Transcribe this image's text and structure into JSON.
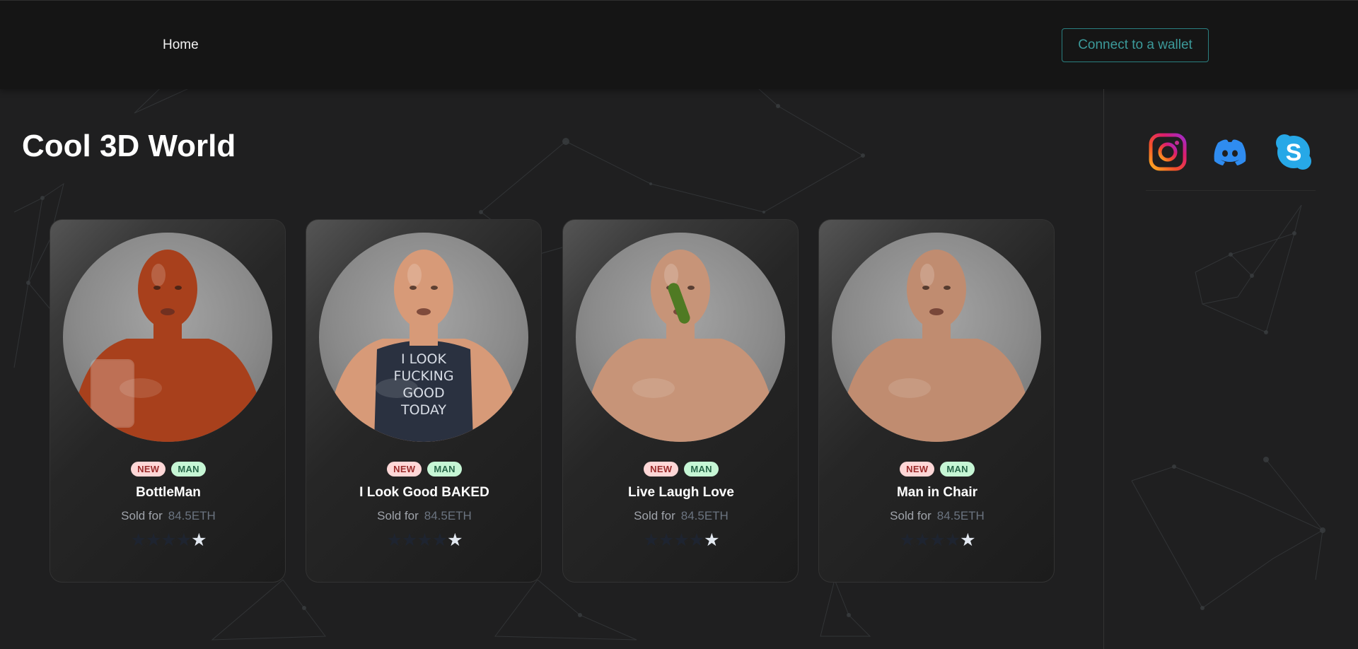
{
  "nav": {
    "home": "Home"
  },
  "wallet": {
    "label": "Connect to a wallet"
  },
  "page": {
    "title": "Cool 3D World"
  },
  "social": [
    "instagram-icon",
    "discord-icon",
    "skype-icon"
  ],
  "cards": [
    {
      "tag_new": "NEW",
      "tag_man": "MAN",
      "name": "BottleMan",
      "sold_label": "Sold for",
      "price": "84.5ETH",
      "rating": 4,
      "rating_max": 5,
      "skin": "#a8401c",
      "shirt": ""
    },
    {
      "tag_new": "NEW",
      "tag_man": "MAN",
      "name": "I Look Good BAKED",
      "sold_label": "Sold for",
      "price": "84.5ETH",
      "rating": 4,
      "rating_max": 5,
      "skin": "#d79a78",
      "shirt": "#2a3140"
    },
    {
      "tag_new": "NEW",
      "tag_man": "MAN",
      "name": "Live Laugh Love",
      "sold_label": "Sold for",
      "price": "84.5ETH",
      "rating": 4,
      "rating_max": 5,
      "skin": "#c79478",
      "shirt": ""
    },
    {
      "tag_new": "NEW",
      "tag_man": "MAN",
      "name": "Man in Chair",
      "sold_label": "Sold for",
      "price": "84.5ETH",
      "rating": 4,
      "rating_max": 5,
      "skin": "#c08c70",
      "shirt": ""
    }
  ],
  "shirt_text": [
    "I LOOK",
    "FUCKING",
    "GOOD",
    "TODAY"
  ],
  "colors": {
    "background": "#1f1f20",
    "topbar": "#151515",
    "accent": "#3c9a9a"
  }
}
